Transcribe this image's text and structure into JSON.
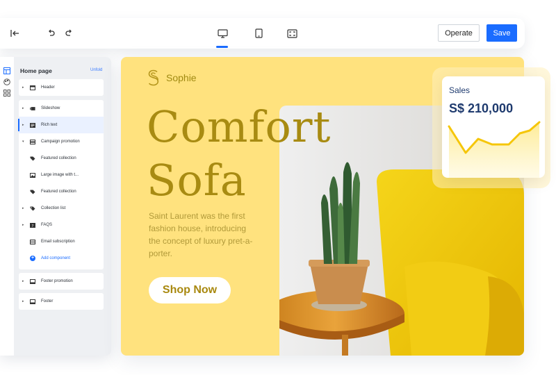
{
  "toolbar": {
    "operate_label": "Operate",
    "save_label": "Save",
    "active_device": "desktop",
    "icons": [
      "exit-icon",
      "undo-icon",
      "redo-icon",
      "desktop-icon",
      "tablet-icon",
      "fullscreen-icon"
    ]
  },
  "panel": {
    "title": "Home page",
    "unfold_label": "Unfold",
    "groups": [
      {
        "items": [
          {
            "label": "Header",
            "icon": "header-icon"
          }
        ]
      },
      {
        "items": [
          {
            "label": "Slideshow",
            "icon": "slideshow-icon"
          },
          {
            "label": "Rich text",
            "icon": "rich-text-icon",
            "active": true
          },
          {
            "label": "Campaign promotion",
            "icon": "campaign-icon"
          },
          {
            "label": "Featured collection",
            "icon": "tag-icon"
          },
          {
            "label": "Large image with t...",
            "icon": "image-icon"
          },
          {
            "label": "Featured collection",
            "icon": "tag-icon"
          },
          {
            "label": "Collection list",
            "icon": "collection-icon"
          },
          {
            "label": "FAQS",
            "icon": "faq-icon"
          },
          {
            "label": "Email subscription",
            "icon": "email-icon"
          },
          {
            "label": "Add component",
            "icon": "plus-icon"
          }
        ]
      },
      {
        "items": [
          {
            "label": "Footer promotion",
            "icon": "footer-promo-icon"
          }
        ]
      },
      {
        "items": [
          {
            "label": "Footer",
            "icon": "footer-icon"
          }
        ]
      }
    ]
  },
  "banner": {
    "brand": "Sophie",
    "headline_line1": "Comfort",
    "headline_line2": "Sofa",
    "description": "Saint Laurent was the first fashion house, introducing the concept of luxury pret-a-porter.",
    "button_label": "Shop Now",
    "background_color": "#ffe27e",
    "accent_color": "#a88b12"
  },
  "sales": {
    "label": "Sales",
    "value": "S$ 210,000",
    "line_color": "#f5c60a"
  },
  "colors": {
    "primary": "#1a6cff"
  }
}
